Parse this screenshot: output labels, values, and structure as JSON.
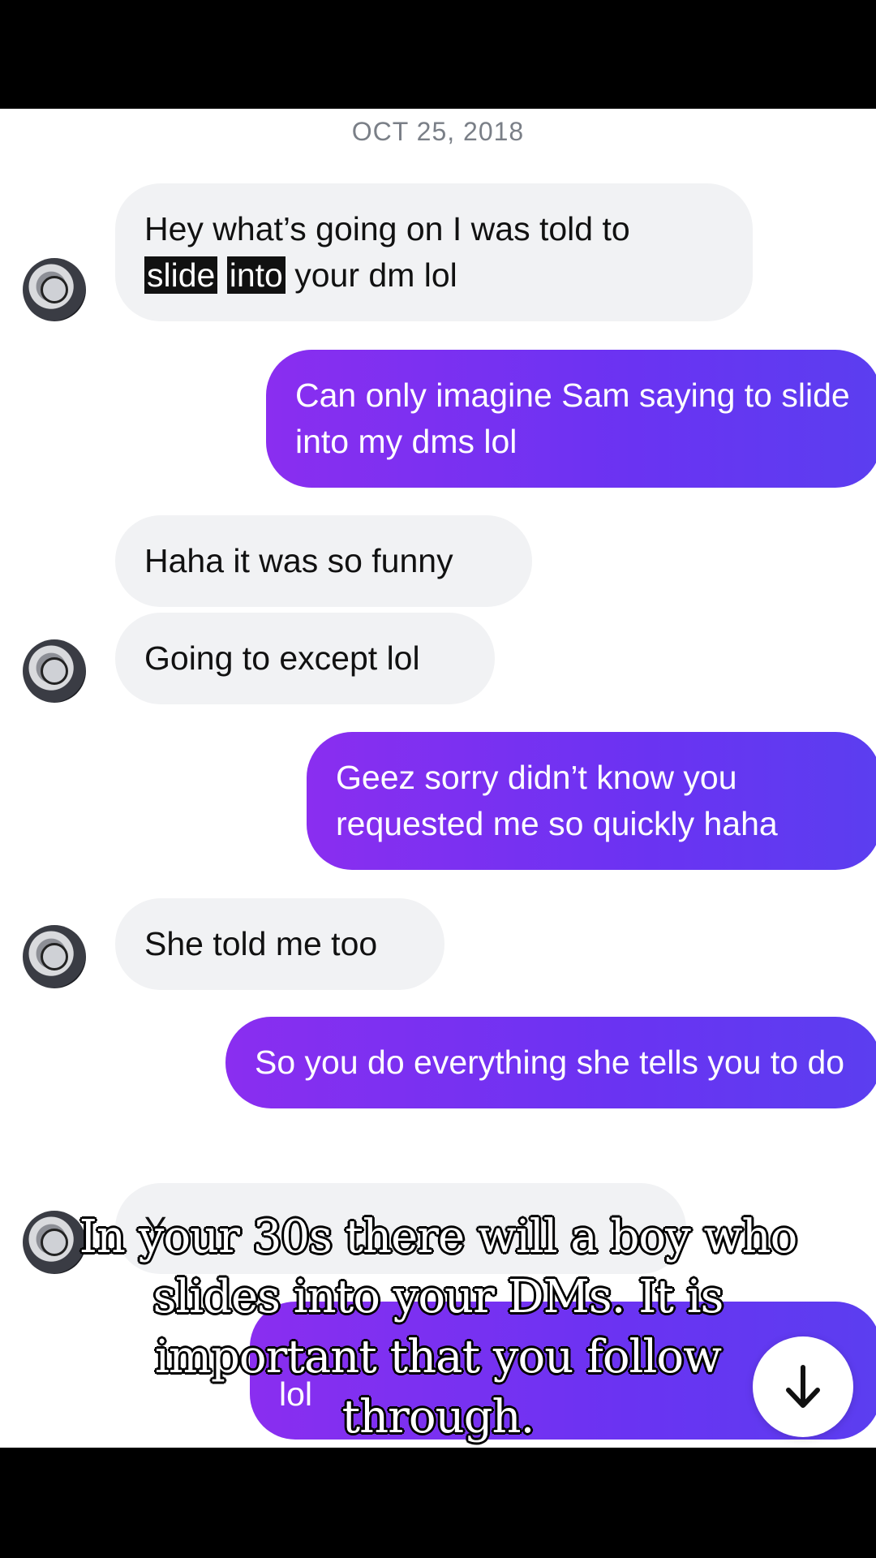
{
  "date_header": "OCT 25, 2018",
  "messages": [
    {
      "from": "them",
      "pre": "Hey what’s going on I was told to",
      "hl1": "slide",
      "hl2": "into",
      "post": "your dm lol"
    },
    {
      "from": "me",
      "text": "Can only imagine Sam saying to slide into my dms lol"
    },
    {
      "from": "them",
      "text": "Haha it was so funny"
    },
    {
      "from": "them",
      "text": "Going to except lol"
    },
    {
      "from": "me",
      "text": "Geez sorry didn’t know you requested me so quickly haha"
    },
    {
      "from": "them",
      "text": "She told me too"
    },
    {
      "from": "me",
      "text": "So you do everything she tells you to do"
    },
    {
      "from": "them",
      "text": "Y"
    },
    {
      "from": "me",
      "text": "lol"
    }
  ],
  "caption": "In your 30s there will a boy who slides into your DMs. It is important that you follow through.",
  "icons": {
    "scroll_down": "arrow-down-icon",
    "avatar": "watch-avatar-icon"
  },
  "colors": {
    "outgoing_start": "#8a2ef0",
    "outgoing_end": "#5b3ef0",
    "incoming": "#f1f2f4"
  }
}
